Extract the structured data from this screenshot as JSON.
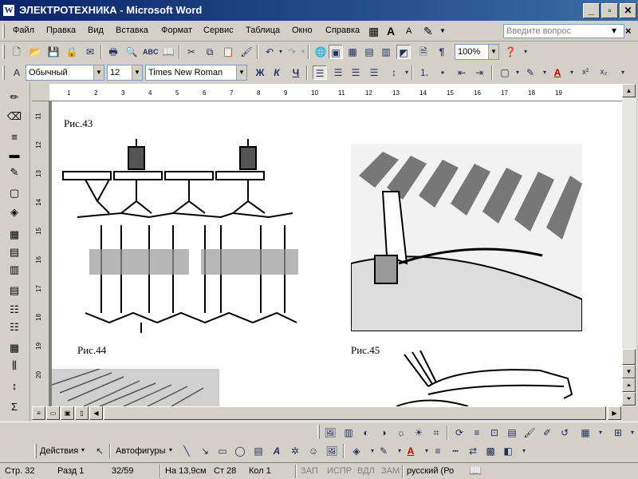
{
  "window": {
    "title": "ЭЛЕКТРОТЕХНИКА - Microsoft Word",
    "app_icon": "W",
    "buttons": {
      "minimize": "_",
      "maximize": "▫",
      "close": "✕"
    }
  },
  "menu": {
    "items": [
      "Файл",
      "Правка",
      "Вид",
      "Вставка",
      "Формат",
      "Сервис",
      "Таблица",
      "Окно",
      "Справка"
    ],
    "ask_placeholder": "Введите вопрос",
    "close_doc": "×"
  },
  "standard_toolbar": {
    "zoom": "100%"
  },
  "format_toolbar": {
    "style": "Обычный",
    "size": "12",
    "font": "Times New Roman",
    "bold": "Ж",
    "italic": "К",
    "underline": "Ч"
  },
  "ruler": {
    "horizontal_ticks": [
      "1",
      "2",
      "3",
      "4",
      "5",
      "6",
      "7",
      "8",
      "9",
      "10",
      "11",
      "12",
      "13",
      "14",
      "15",
      "16",
      "17",
      "18",
      "19"
    ],
    "vertical_ticks": [
      "11",
      "12",
      "13",
      "14",
      "15",
      "16",
      "17",
      "18",
      "19",
      "20"
    ]
  },
  "document": {
    "captions": [
      "Рис.43",
      "Рис.44",
      "Рис.45"
    ]
  },
  "drawing_toolbar": {
    "actions_label": "Действия",
    "autoshapes_label": "Автофигуры"
  },
  "status": {
    "page": "Стр.  32",
    "section": "Разд  1",
    "pages": "32/59",
    "at": "На 13,9см",
    "line": "Ст  28",
    "col": "Кол  1",
    "rec": "ЗАП",
    "trk": "ИСПР",
    "ext": "ВДЛ",
    "ovr": "ЗАМ",
    "language": "русский (Ро"
  },
  "colors": {
    "title_gradient_start": "#0a246a",
    "title_gradient_end": "#3a6ea5",
    "chrome": "#d4d0c8"
  }
}
